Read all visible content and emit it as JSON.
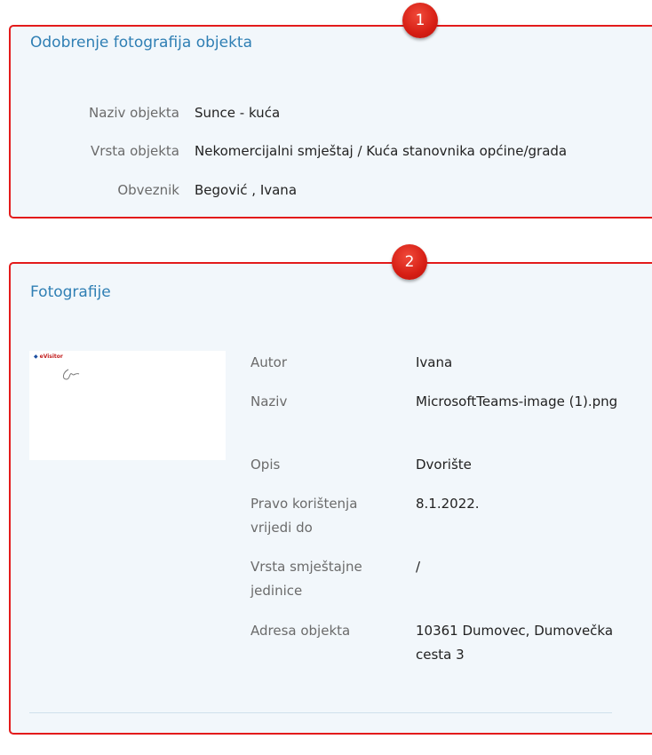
{
  "badges": {
    "first": "1",
    "second": "2"
  },
  "approval": {
    "title": "Odobrenje fotografija objekta",
    "fields": [
      {
        "label": "Naziv objekta",
        "value": "Sunce - kuća"
      },
      {
        "label": "Vrsta objekta",
        "value": "Nekomercijalni smještaj / Kuća stanovnika općine/grada"
      },
      {
        "label": "Obveznik",
        "value": "Begović , Ivana"
      }
    ]
  },
  "photos": {
    "title": "Fotografije",
    "thumbnail": {
      "logo_text": "eVisitor",
      "icon": "evisitor-logo-icon"
    },
    "fields": [
      {
        "label": "Autor",
        "value": "Ivana"
      },
      {
        "label": "Naziv",
        "value": "MicrosoftTeams-image (1).png"
      },
      {
        "label": "Opis",
        "value": "Dvorište"
      },
      {
        "label": "Pravo korištenja vrijedi do",
        "value": "8.1.2022."
      },
      {
        "label": "Vrsta smještajne jedinice",
        "value": "/"
      },
      {
        "label": "Adresa objekta",
        "value": "10361 Dumovec, Dumovečka cesta 3"
      }
    ]
  },
  "colors": {
    "accent": "#2f7fb4",
    "highlight": "#e31b1b",
    "panel_bg": "#f2f7fb"
  }
}
